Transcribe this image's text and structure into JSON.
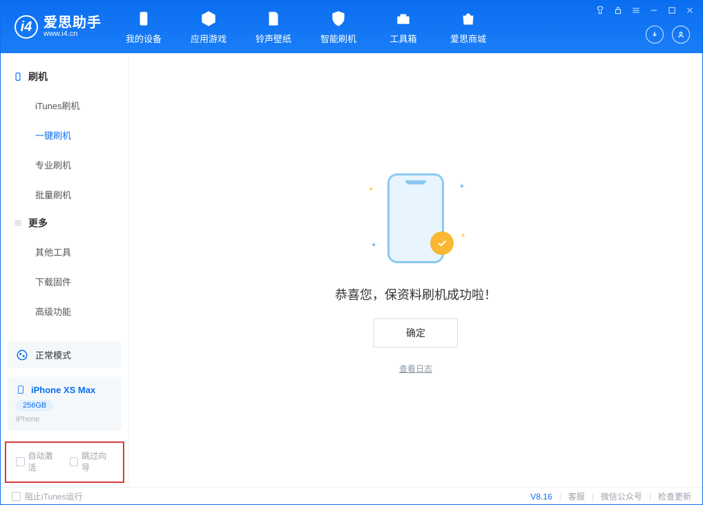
{
  "app": {
    "name": "爱思助手",
    "url": "www.i4.cn"
  },
  "nav": [
    {
      "label": "我的设备"
    },
    {
      "label": "应用游戏"
    },
    {
      "label": "铃声壁纸"
    },
    {
      "label": "智能刷机"
    },
    {
      "label": "工具箱"
    },
    {
      "label": "爱思商城"
    }
  ],
  "sidebar": {
    "s1": {
      "title": "刷机",
      "items": [
        "iTunes刷机",
        "一键刷机",
        "专业刷机",
        "批量刷机"
      ]
    },
    "s2": {
      "title": "更多",
      "items": [
        "其他工具",
        "下载固件",
        "高级功能"
      ]
    }
  },
  "mode": {
    "label": "正常模式"
  },
  "device": {
    "name": "iPhone XS Max",
    "capacity": "256GB",
    "type": "iPhone"
  },
  "cb": {
    "a": "自动激活",
    "b": "跳过向导"
  },
  "main": {
    "msg": "恭喜您，保资料刷机成功啦！",
    "ok": "确定",
    "log": "查看日志"
  },
  "footer": {
    "block": "阻止iTunes运行",
    "ver": "V8.16",
    "a": "客服",
    "b": "微信公众号",
    "c": "检查更新"
  }
}
